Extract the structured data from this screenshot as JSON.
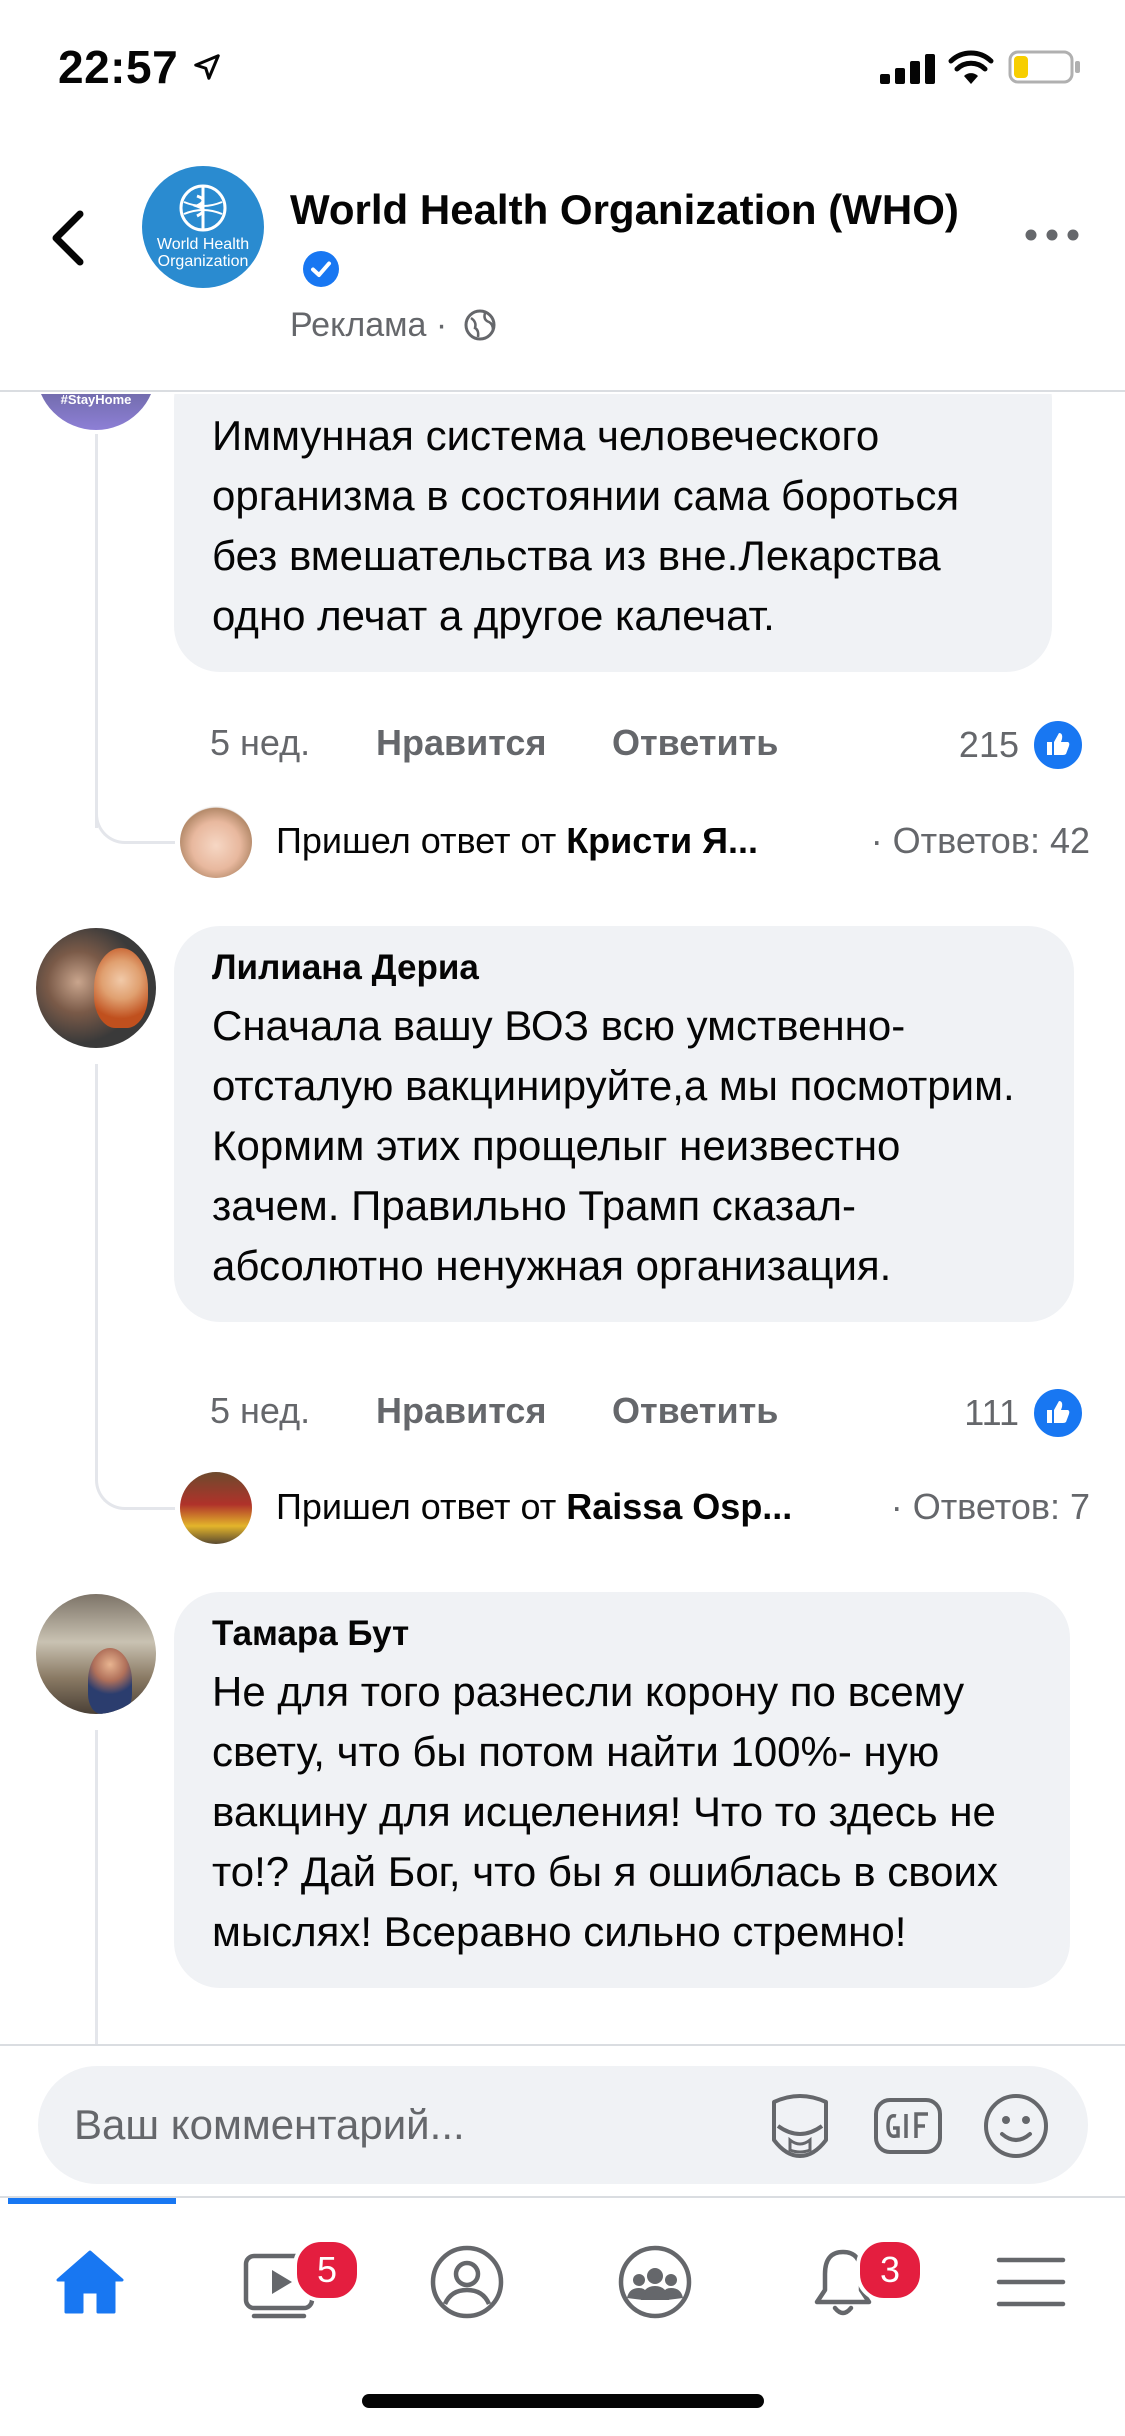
{
  "status_bar": {
    "time": "22:57"
  },
  "header": {
    "title": "World Health Organization (WHO)",
    "sponsored_label": "Реклама ·",
    "avatar_text": "World Health Organization",
    "verified_icon": "verified-badge-icon"
  },
  "comments": [
    {
      "text": "Иммунная система человеческого организма в состоянии сама бороться без вмешательства из вне.Лекарства одно лечат а другое калечат.",
      "time": "5 нед.",
      "like_label": "Нравится",
      "reply_label": "Ответить",
      "reaction_count": "215",
      "replies_prefix": "Пришел ответ от ",
      "replies_author": "Кристи Я...",
      "replies_count": "· Ответов: 42"
    },
    {
      "author": "Лилиана Дериа",
      "text": "Сначала вашу ВОЗ всю умственно-отсталую вакцинируйте,а мы посмотрим. Кормим этих прощелыг неизвестно зачем. Правильно Трамп сказал-абсолютно ненужная организация.",
      "time": "5 нед.",
      "like_label": "Нравится",
      "reply_label": "Ответить",
      "reaction_count": "111",
      "replies_prefix": "Пришел ответ от ",
      "replies_author": "Raissa Osp...",
      "replies_count": "· Ответов: 7"
    },
    {
      "author": "Тамара Бут",
      "text": "Не для того разнесли корону по всему свету, что бы потом найти 100%- ную вакцину для исцеления! Что то здесь не то!? Дай Бог, что бы я ошиблась в своих мыслях! Всеравно сильно стремно!"
    }
  ],
  "composer": {
    "placeholder": "Ваш комментарий..."
  },
  "tabbar": {
    "watch_badge": "5",
    "notifications_badge": "3"
  },
  "colors": {
    "accent": "#1877f2",
    "bubble": "#f0f2f5",
    "secondary_text": "#65676b",
    "badge_red": "#e41e3f"
  }
}
